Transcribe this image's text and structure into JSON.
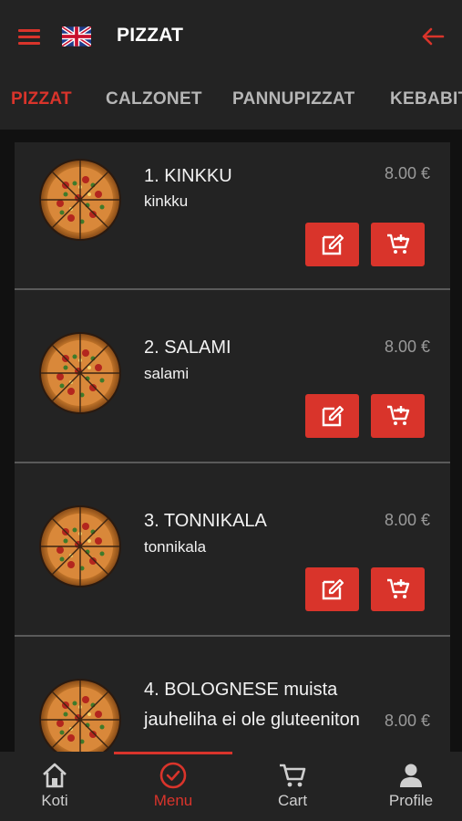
{
  "header": {
    "title": "PIZZAT",
    "menu_icon": "hamburger-menu-icon",
    "flag_icon": "uk-flag-icon",
    "back_icon": "arrow-left-icon"
  },
  "colors": {
    "accent": "#d9342b",
    "background": "#111111",
    "surface": "#232323",
    "muted_text": "#9a9a9a"
  },
  "tabs": [
    {
      "label": "PIZZAT",
      "active": true
    },
    {
      "label": "CALZONET",
      "active": false
    },
    {
      "label": "PANNUPIZZAT",
      "active": false
    },
    {
      "label": "KEBABIT",
      "active": false
    }
  ],
  "items": [
    {
      "name": "1. KINKKU",
      "desc": "kinkku",
      "price": "8.00 €"
    },
    {
      "name": "2. SALAMI",
      "desc": "salami",
      "price": "8.00 €"
    },
    {
      "name": "3. TONNIKALA",
      "desc": "tonnikala",
      "price": "8.00 €"
    },
    {
      "name": "4. BOLOGNESE muista jauheliha ei ole gluteeniton",
      "desc": "",
      "price": "8.00 €"
    }
  ],
  "item_buttons": {
    "edit_icon": "edit-icon",
    "add_to_cart_icon": "add-to-cart-icon"
  },
  "nav": [
    {
      "label": "Koti",
      "icon": "home-icon",
      "active": false
    },
    {
      "label": "Menu",
      "icon": "check-circle-icon",
      "active": true
    },
    {
      "label": "Cart",
      "icon": "cart-icon",
      "active": false
    },
    {
      "label": "Profile",
      "icon": "person-icon",
      "active": false
    }
  ]
}
